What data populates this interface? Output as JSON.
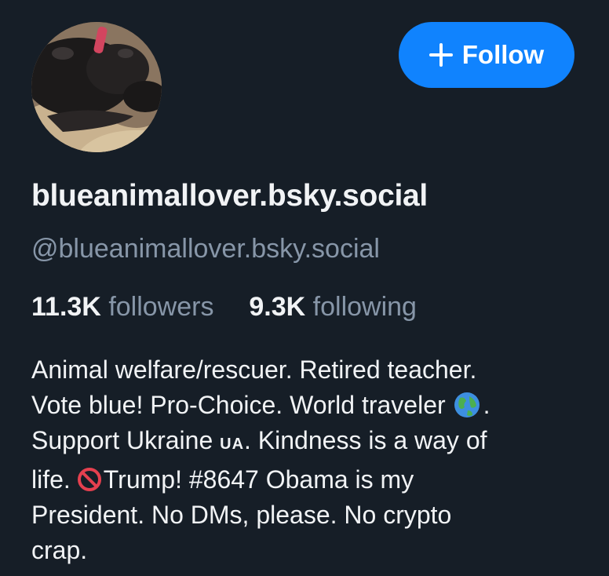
{
  "profile": {
    "display_name": "blueanimallover.bsky.social",
    "handle": "@blueanimallover.bsky.social",
    "avatar_icon": "dog-photo-avatar"
  },
  "follow_button": {
    "label": "Follow",
    "icon": "plus-icon",
    "color": "#1083fe"
  },
  "stats": {
    "followers_count": "11.3K",
    "followers_label": "followers",
    "following_count": "9.3K",
    "following_label": "following"
  },
  "bio": {
    "line1": "Animal welfare/rescuer. Retired teacher.",
    "line2_a": "Vote blue! Pro-Choice. World traveler",
    "line2_emoji": "globe-icon",
    "line2_b": ".",
    "line3_a": "Support Ukraine",
    "line3_flag": "UA",
    "line3_b": ". Kindness is a way of",
    "line4_a": "life.",
    "line4_emoji": "no-entry-icon",
    "line4_b": "Trump! #8647 Obama is my",
    "line5": "President. No DMs, please. No crypto",
    "line6": "crap."
  },
  "colors": {
    "background": "#161e27",
    "text_primary": "#f1f3f5",
    "text_secondary": "#8796a8",
    "accent": "#1083fe"
  }
}
